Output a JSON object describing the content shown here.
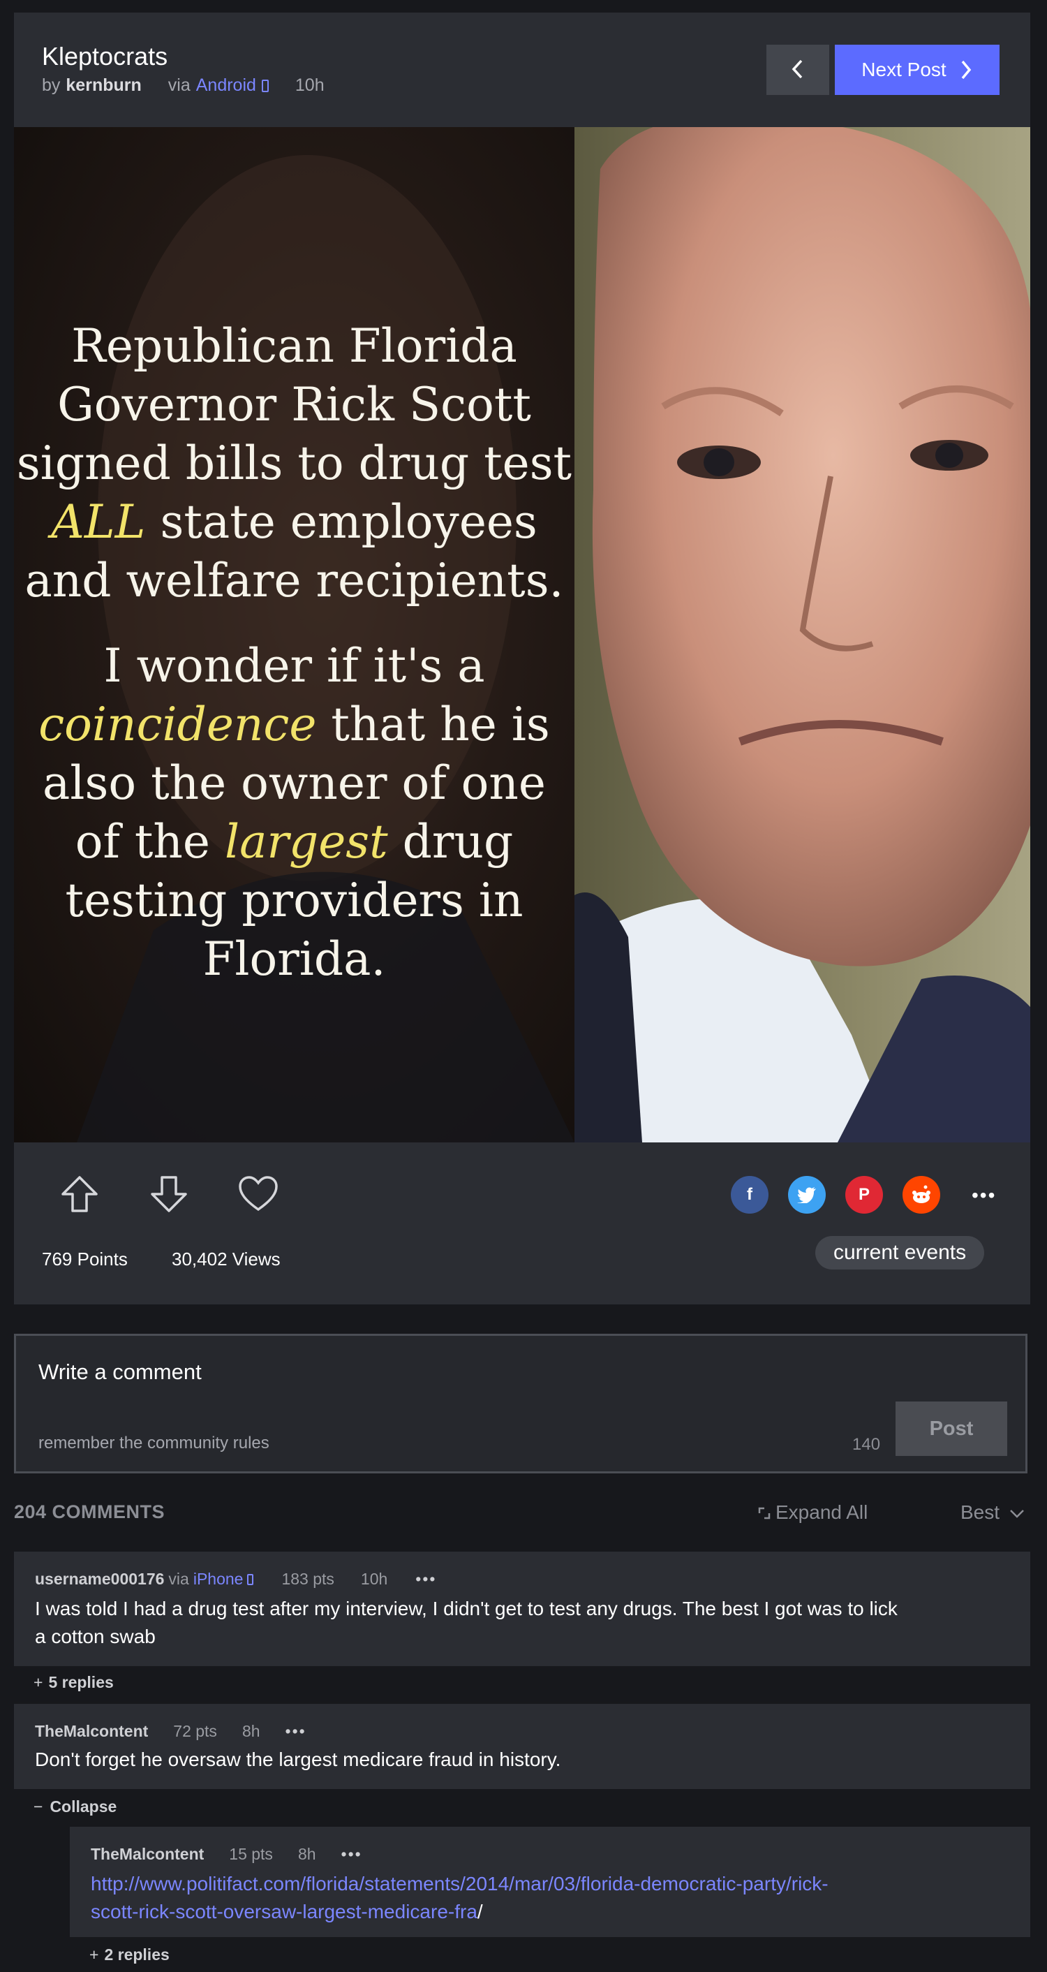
{
  "post": {
    "title": "Kleptocrats",
    "by_label": "by",
    "author": "kernburn",
    "via_label": "via",
    "platform": "Android",
    "time": "10h",
    "next_label": "Next Post",
    "image_text": {
      "p1_l1": "Republican Florida",
      "p1_l2": "Governor Rick Scott",
      "p1_l3": "signed bills to drug test",
      "p1_l4a": "ALL",
      "p1_l4b": " state employees",
      "p1_l5": "and welfare recipients.",
      "p2_l1": "I wonder if it's a",
      "p2_l2a": "coincidence",
      "p2_l2b": " that he is",
      "p2_l3": "also the owner of  one",
      "p2_l4a": "of the ",
      "p2_l4b": "largest",
      "p2_l4c": " drug",
      "p2_l5": "testing providers in",
      "p2_l6": "Florida."
    },
    "points": "769 Points",
    "views": "30,402 Views",
    "tag": "current events",
    "share_icons": [
      "facebook-icon",
      "twitter-icon",
      "pinterest-icon",
      "reddit-icon"
    ]
  },
  "composer": {
    "placeholder": "Write a comment",
    "rules": "remember the community rules",
    "char_count": "140",
    "post_label": "Post"
  },
  "comments_bar": {
    "count": "204 COMMENTS",
    "expand_all": "Expand All",
    "sort": "Best"
  },
  "comments": [
    {
      "user": "username000176",
      "via": "via",
      "platform": "iPhone",
      "pts": "183 pts",
      "time": "10h",
      "body_l1": "I was told I had a drug test after my interview, I didn't get to test any drugs. The best I got was to lick",
      "body_l2": "a cotton swab",
      "replies": "5 replies"
    },
    {
      "user": "TheMalcontent",
      "pts": "72 pts",
      "time": "8h",
      "body": "Don't forget he oversaw the largest medicare fraud in history.",
      "collapse": "Collapse"
    },
    {
      "user": "TheMalcontent",
      "pts": "15 pts",
      "time": "8h",
      "link_l1": "http://www.politifact.com/florida/statements/2014/mar/03/florida-democratic-party/rick-",
      "link_l2": "scott-rick-scott-oversaw-largest-medicare-fra",
      "link_tail": "/",
      "replies": "2 replies"
    }
  ],
  "colors": {
    "accent": "#5c6bff",
    "link": "#7b86ff",
    "facebook": "#3b5998",
    "twitter": "#3da2f2",
    "pinterest": "#e02834",
    "reddit": "#ff4500"
  }
}
